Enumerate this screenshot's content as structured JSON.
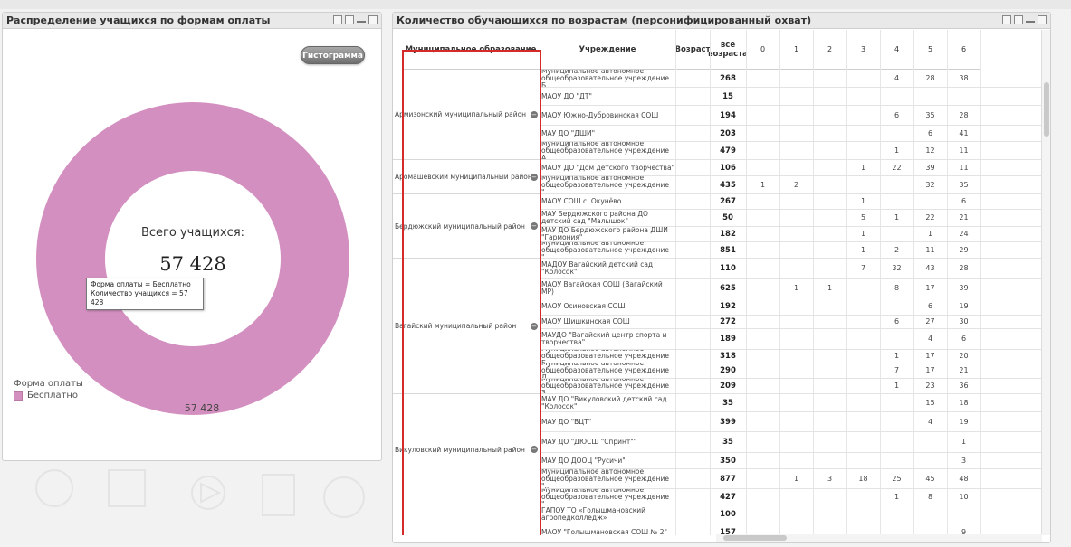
{
  "left_panel": {
    "title": "Распределение учащихся по формам оплаты",
    "histogram_button": "Гистограмма",
    "donut_total_label": "Всего учащихся:",
    "donut_total_value": "57 428",
    "tooltip_line1": "Форма оплаты = Бесплатно",
    "tooltip_line2": "Количество учащихся = 57 428",
    "bottom_value": "57 428",
    "legend_title": "Форма оплаты",
    "legend_item": "Бесплатно",
    "donut_color": "#d38fbf"
  },
  "chart_data": {
    "type": "pie",
    "categories": [
      "Бесплатно"
    ],
    "values": [
      57428
    ],
    "title": "Распределение учащихся по формам оплаты"
  },
  "right_panel": {
    "title": "Количество обучающихся по возрастам (персонифицированный охват)",
    "headers": {
      "muni": "Муниципальное образование",
      "inst": "Учреждение",
      "age": "Возраст",
      "total": "все возраста",
      "ages": [
        "0",
        "1",
        "2",
        "3",
        "4",
        "5",
        "6"
      ]
    },
    "munis": [
      {
        "name": "Армизонский муниципальный район"
      },
      {
        "name": "Аромашевский муниципальный район"
      },
      {
        "name": "Бердюжский муниципальный район"
      },
      {
        "name": "Вагайский муниципальный район"
      },
      {
        "name": "Викуловский муниципальный район"
      }
    ],
    "rows": [
      {
        "inst": "Муниципальное автономное общеобразовательное учреждение Б...",
        "total": "268",
        "ages": [
          "",
          "",
          "",
          "",
          "4",
          "28",
          "38"
        ]
      },
      {
        "inst": "МАОУ ДО \"ДТ\"",
        "total": "15",
        "ages": [
          "",
          "",
          "",
          "",
          "",
          "",
          ""
        ]
      },
      {
        "inst": "МАОУ Южно-Дубровинская СОШ",
        "total": "194",
        "ages": [
          "",
          "",
          "",
          "",
          "6",
          "35",
          "28"
        ]
      },
      {
        "inst": "МАУ ДО \"ДШИ\"",
        "total": "203",
        "ages": [
          "",
          "",
          "",
          "",
          "",
          "6",
          "41"
        ]
      },
      {
        "inst": "Муниципальное автономное общеобразовательное учреждение А...",
        "total": "479",
        "ages": [
          "",
          "",
          "",
          "",
          "1",
          "12",
          "11"
        ]
      },
      {
        "inst": "МАОУ ДО \"Дом детского творчества\"",
        "total": "106",
        "ages": [
          "",
          "",
          "",
          "1",
          "22",
          "39",
          "11"
        ]
      },
      {
        "inst": "Муниципальное автономное общеобразовательное учреждение \"...",
        "total": "435",
        "ages": [
          "1",
          "2",
          "",
          "",
          "",
          "32",
          "35"
        ]
      },
      {
        "inst": "МАОУ СОШ с. Окунёво",
        "total": "267",
        "ages": [
          "",
          "",
          "",
          "1",
          "",
          "",
          "6"
        ]
      },
      {
        "inst": "МАУ Бердюжского района ДО детский сад \"Малышок\"",
        "total": "50",
        "ages": [
          "",
          "",
          "",
          "5",
          "1",
          "22",
          "21"
        ]
      },
      {
        "inst": "МАУ ДО Бердюжского района ДШИ \"Гармония\"",
        "total": "182",
        "ages": [
          "",
          "",
          "",
          "1",
          "",
          "1",
          "24"
        ]
      },
      {
        "inst": "Муниципальное автономное общеобразовательное учреждение \"...",
        "total": "851",
        "ages": [
          "",
          "",
          "",
          "1",
          "2",
          "11",
          "29"
        ]
      },
      {
        "inst": "МАДОУ Вагайский детский сад \"Колосок\"",
        "total": "110",
        "ages": [
          "",
          "",
          "",
          "7",
          "32",
          "43",
          "28"
        ]
      },
      {
        "inst": "МАОУ Вагайская СОШ (Вагайский МР)",
        "total": "625",
        "ages": [
          "",
          "1",
          "1",
          "",
          "8",
          "17",
          "39"
        ]
      },
      {
        "inst": "МАОУ Осиновская СОШ",
        "total": "192",
        "ages": [
          "",
          "",
          "",
          "",
          "",
          "6",
          "19"
        ]
      },
      {
        "inst": "МАОУ Шишкинская СОШ",
        "total": "272",
        "ages": [
          "",
          "",
          "",
          "",
          "6",
          "27",
          "30"
        ]
      },
      {
        "inst": "МАУДО \"Вагайский центр спорта и творчества\"",
        "total": "189",
        "ages": [
          "",
          "",
          "",
          "",
          "",
          "4",
          "6"
        ]
      },
      {
        "inst": "Муниципальное автономное общеобразовательное учреждение Б...",
        "total": "318",
        "ages": [
          "",
          "",
          "",
          "",
          "1",
          "17",
          "20"
        ]
      },
      {
        "inst": "Муниципальное автономное общеобразовательное учреждение Д...",
        "total": "290",
        "ages": [
          "",
          "",
          "",
          "",
          "7",
          "17",
          "21"
        ]
      },
      {
        "inst": "Муниципальное автономное общеобразовательное учреждение З...",
        "total": "209",
        "ages": [
          "",
          "",
          "",
          "",
          "1",
          "23",
          "36"
        ]
      },
      {
        "inst": "МАУ ДО \"Викуловский детский сад \"Колосок\"",
        "total": "35",
        "ages": [
          "",
          "",
          "",
          "",
          "",
          "15",
          "18"
        ]
      },
      {
        "inst": "МАУ ДО \"ВЦТ\"",
        "total": "399",
        "ages": [
          "",
          "",
          "",
          "",
          "",
          "4",
          "19"
        ]
      },
      {
        "inst": "МАУ ДО \"ДЮСШ \"Спринт\"\"",
        "total": "35",
        "ages": [
          "",
          "",
          "",
          "",
          "",
          "",
          "1"
        ]
      },
      {
        "inst": "МАУ ДО ДООЦ \"Русичи\"",
        "total": "350",
        "ages": [
          "",
          "",
          "",
          "",
          "",
          "",
          "3"
        ]
      },
      {
        "inst": "Муниципальное автономное общеобразовательное учреждение \"...",
        "total": "877",
        "ages": [
          "",
          "1",
          "3",
          "18",
          "25",
          "45",
          "48"
        ]
      },
      {
        "inst": "Муниципальное автономное общеобразовательное учреждение \"...",
        "total": "427",
        "ages": [
          "",
          "",
          "",
          "",
          "1",
          "8",
          "10"
        ]
      },
      {
        "inst": "ГАПОУ ТО «Голышмановский агропедколледж»",
        "total": "100",
        "ages": [
          "",
          "",
          "",
          "",
          "",
          "",
          ""
        ]
      },
      {
        "inst": "МАОУ \"Голышмановская СОШ № 2\"",
        "total": "157",
        "ages": [
          "",
          "",
          "",
          "",
          "",
          "",
          "9"
        ]
      }
    ]
  }
}
